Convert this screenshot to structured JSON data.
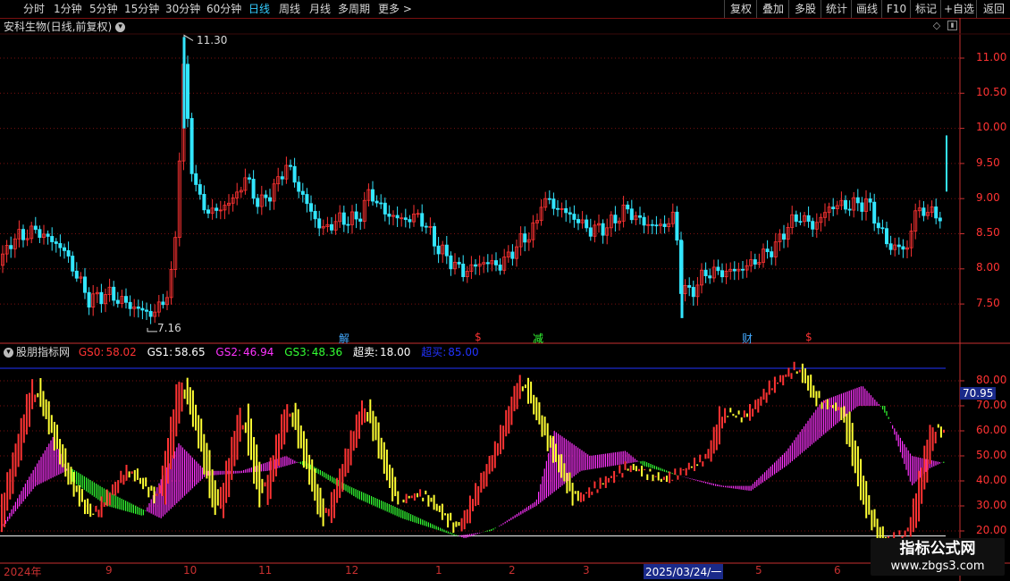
{
  "topbar": {
    "periods": [
      "分时",
      "1分钟",
      "5分钟",
      "15分钟",
      "30分钟",
      "60分钟",
      "日线",
      "周线",
      "月线",
      "多周期",
      "更多 >"
    ],
    "active_period": "日线",
    "right_buttons": [
      "复权",
      "叠加",
      "多股",
      "统计",
      "画线",
      "F10",
      "标记",
      "+自选",
      "返回"
    ]
  },
  "main": {
    "title": "安科生物(日线,前复权)",
    "y_labels": [
      "11.00",
      "10.50",
      "10.00",
      "9.50",
      "9.00",
      "8.50",
      "8.00",
      "7.50"
    ],
    "high_label": "11.30",
    "low_label": "7.16",
    "markers": [
      {
        "text": "解",
        "color": "#44aaff"
      },
      {
        "text": "$",
        "color": "#ff3333"
      },
      {
        "text": "减",
        "color": "#33ff33"
      },
      {
        "text": "财",
        "color": "#44aaff"
      },
      {
        "text": "$",
        "color": "#ff3333"
      }
    ]
  },
  "indicator": {
    "name": "股朋指标网",
    "items": [
      {
        "label": "GS0:",
        "value": "58.02",
        "color": "#ff3333"
      },
      {
        "label": "GS1:",
        "value": "58.65",
        "color": "#ffffff"
      },
      {
        "label": "GS2:",
        "value": "46.94",
        "color": "#ff33ff"
      },
      {
        "label": "GS3:",
        "value": "48.36",
        "color": "#33ff33"
      },
      {
        "label": "超卖:",
        "value": "18.00",
        "color": "#ffffff"
      },
      {
        "label": "超买:",
        "value": "85.00",
        "color": "#2233ff"
      }
    ],
    "y_labels": [
      "80.00",
      "70.00",
      "60.00",
      "50.00",
      "40.00",
      "30.00",
      "20.00"
    ],
    "current_value": "70.95"
  },
  "x_axis": {
    "labels": [
      "2024年",
      "9",
      "10",
      "11",
      "12",
      "1",
      "2",
      "3",
      "2025/03/24/一",
      "5",
      "6"
    ]
  },
  "watermark": {
    "title": "指标公式网",
    "url": "www.zbgs3.com"
  },
  "colors": {
    "up": "#ff3333",
    "down": "#33e6ff",
    "grid": "#7a1010",
    "gs1": "#ffff33",
    "gs2": "#ff33ff",
    "gs3": "#33ff33"
  }
}
